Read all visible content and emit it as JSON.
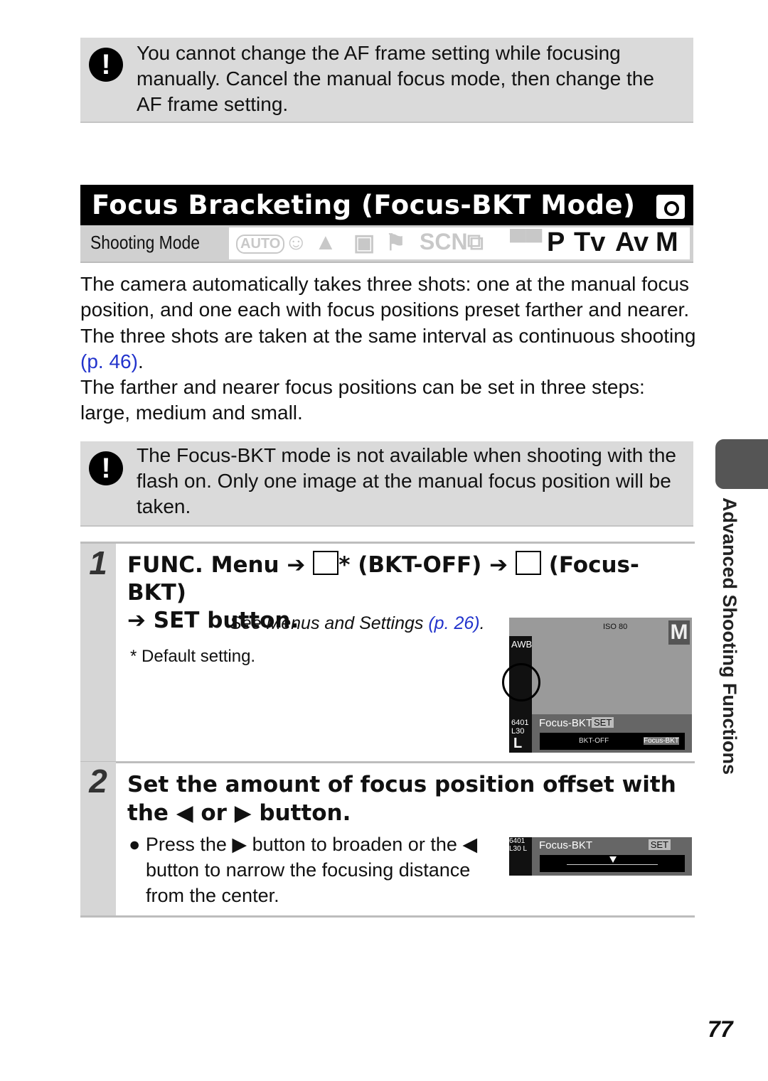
{
  "note1": {
    "icon": "caution-icon",
    "text": "You cannot change the AF frame setting while focusing manually. Cancel the manual focus mode, then change the AF frame setting."
  },
  "title": "Focus Bracketing (Focus-BKT Mode)",
  "shooting_mode": {
    "label": "Shooting Mode",
    "modes": [
      {
        "label": "AUTO",
        "active": false
      },
      {
        "label": "☺",
        "active": false
      },
      {
        "label": "▲",
        "active": false
      },
      {
        "label": "▣",
        "active": false
      },
      {
        "label": "⚑",
        "active": false
      },
      {
        "label": "SCN",
        "active": false
      },
      {
        "label": "⧉",
        "active": false
      },
      {
        "label": "▀▀",
        "active": false
      },
      {
        "label": "P",
        "active": true
      },
      {
        "label": "Tv",
        "active": true
      },
      {
        "label": "Av",
        "active": true
      },
      {
        "label": "M",
        "active": true
      }
    ]
  },
  "body": {
    "p1": "The camera automatically takes three shots: one at the manual focus position, and one each with focus positions preset farther and nearer. The three shots are taken at the same interval as continuous shooting ",
    "p1_link": "(p. 46)",
    "p1_end": ".",
    "p2": "The farther and nearer focus positions can be set in three steps: large, medium and small."
  },
  "note2": {
    "icon": "caution-icon",
    "text": "The Focus-BKT mode is not available when shooting with the flash on. Only one image at the manual focus position will be taken."
  },
  "step1": {
    "num": "1",
    "h_a": "FUNC. Menu ➔ ",
    "h_b": "* (BKT-OFF) ➔ ",
    "h_c": " (Focus-BKT)",
    "h_d": "➔ SET button.",
    "see": "See Menus and Settings ",
    "see_link": "(p. 26)",
    "see_end": ".",
    "default": "* Default setting.",
    "lcd": {
      "iso": "ISO 80",
      "mode": "M",
      "left_icons": [
        "AWB",
        "6401 L30",
        "L"
      ],
      "label": "Focus-BKT",
      "set": "SET",
      "options": [
        "BKT-OFF",
        "Focus-BKT"
      ]
    }
  },
  "step2": {
    "num": "2",
    "heading": "Set the amount of focus position offset with the ◀ or ▶ button.",
    "bullet": "Press the ▶ button to broaden or the ◀ button to narrow the focusing distance from the center.",
    "lcd": {
      "label": "Focus-BKT",
      "set": "SET",
      "size": "6401 L30 L"
    }
  },
  "side_label": "Advanced Shooting Functions",
  "page_number": "77"
}
